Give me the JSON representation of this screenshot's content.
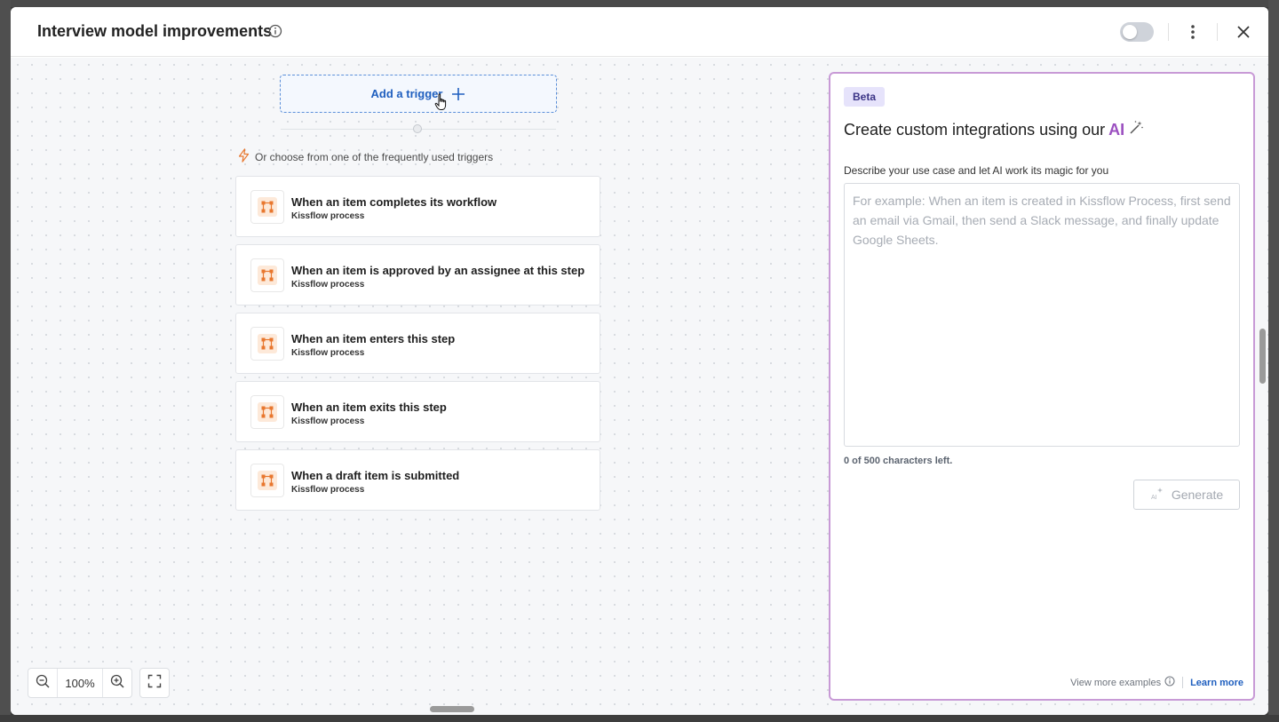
{
  "header": {
    "title": "Interview model improvements",
    "toggle_state": "off"
  },
  "canvas": {
    "add_trigger_label": "Add a trigger",
    "frequent_label": "Or choose from one of the frequently used triggers",
    "triggers": [
      {
        "title": "When an item completes its workflow",
        "subtitle": "Kissflow process"
      },
      {
        "title": "When an item is approved by an assignee at this step",
        "subtitle": "Kissflow process"
      },
      {
        "title": "When an item enters this step",
        "subtitle": "Kissflow process"
      },
      {
        "title": "When an item exits this step",
        "subtitle": "Kissflow process"
      },
      {
        "title": "When a draft item is submitted",
        "subtitle": "Kissflow process"
      }
    ],
    "zoom_level": "100%"
  },
  "ai_panel": {
    "badge": "Beta",
    "heading_prefix": "Create custom integrations using our",
    "heading_ai": "AI",
    "description_label": "Describe your use case and let AI work its magic for you",
    "textarea_value": "",
    "textarea_placeholder": "For example: When an item is created in Kissflow Process, first send an email via Gmail, then send a Slack message, and finally update Google Sheets.",
    "char_count": "0 of 500 characters left.",
    "generate_label": "Generate",
    "view_more_label": "View more examples",
    "learn_more_label": "Learn more"
  },
  "colors": {
    "accent_blue": "#1f5fbf",
    "ai_purple": "#9b4fc0",
    "panel_border": "#c89ad6",
    "trigger_icon_orange": "#e8772e"
  }
}
